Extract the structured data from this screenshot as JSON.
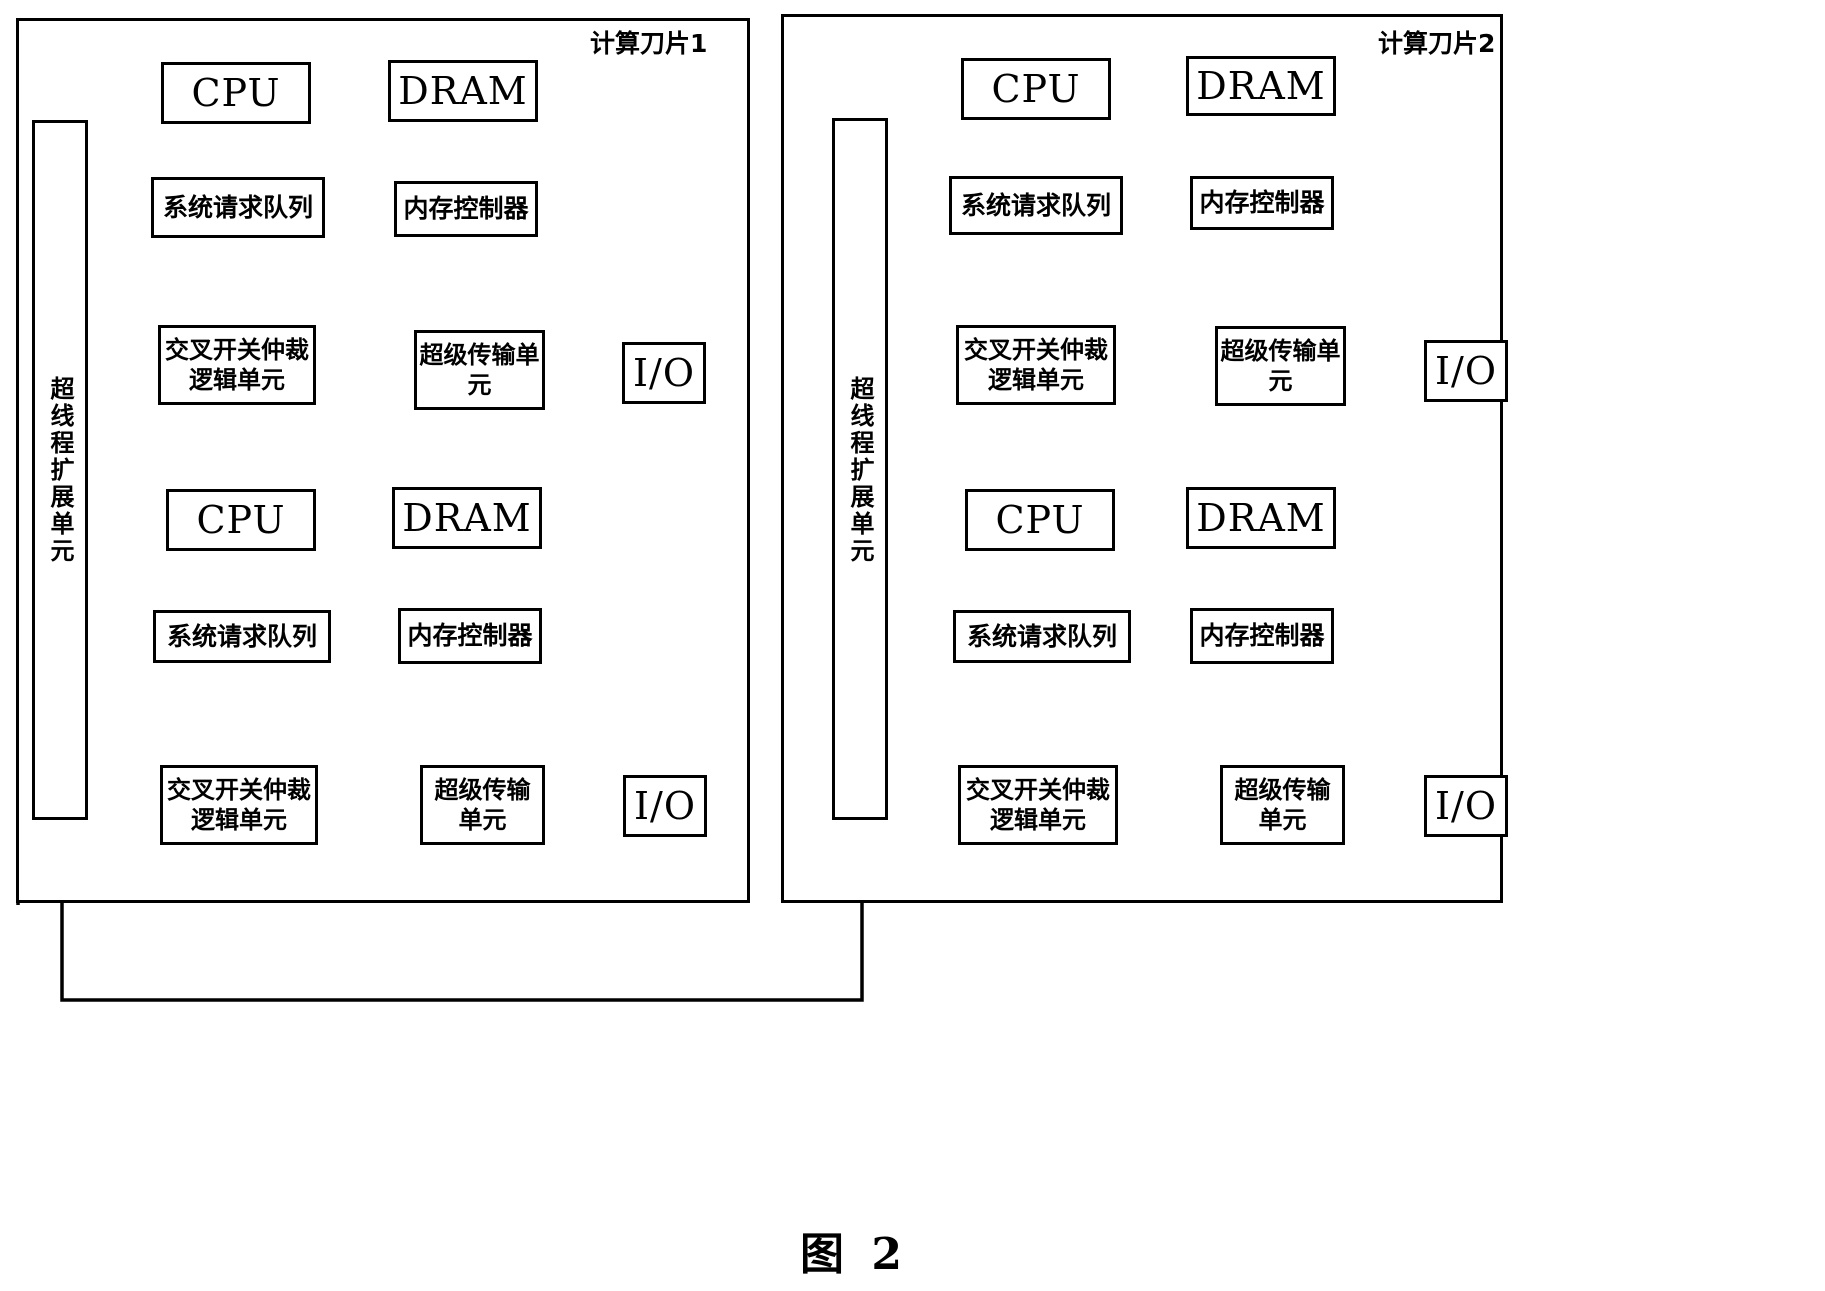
{
  "figure": {
    "caption": "图  2",
    "caption_number": "2"
  },
  "panels": [
    {
      "id": "blade1",
      "title": "计算刀片1",
      "hyperthread_unit": "超线程扩展单元",
      "nodes": [
        {
          "id": "node1",
          "cpu": "CPU",
          "dram": "DRAM",
          "request_queue": "系统请求队列",
          "memory_controller": "内存控制器",
          "crossbar": "交叉开关仲裁逻辑单元",
          "hypertransport": "超级传输单元",
          "io": "I/O"
        },
        {
          "id": "node2",
          "cpu": "CPU",
          "dram": "DRAM",
          "request_queue": "系统请求队列",
          "memory_controller": "内存控制器",
          "crossbar": "交叉开关仲裁逻辑单元",
          "hypertransport": "超级传输单元",
          "io": "I/O"
        }
      ]
    },
    {
      "id": "blade2",
      "title": "计算刀片2",
      "hyperthread_unit": "超线程扩展单元",
      "nodes": [
        {
          "id": "node1",
          "cpu": "CPU",
          "dram": "DRAM",
          "request_queue": "系统请求队列",
          "memory_controller": "内存控制器",
          "crossbar": "交叉开关仲裁逻辑单元",
          "hypertransport": "超级传输单元",
          "io": "I/O"
        },
        {
          "id": "node2",
          "cpu": "CPU",
          "dram": "DRAM",
          "request_queue": "系统请求队列",
          "memory_controller": "内存控制器",
          "crossbar": "交叉开关仲裁逻辑单元",
          "hypertransport": "超级传输单元",
          "io": "I/O"
        }
      ]
    }
  ],
  "colors": {
    "stroke": "#000000",
    "background": "#ffffff"
  }
}
